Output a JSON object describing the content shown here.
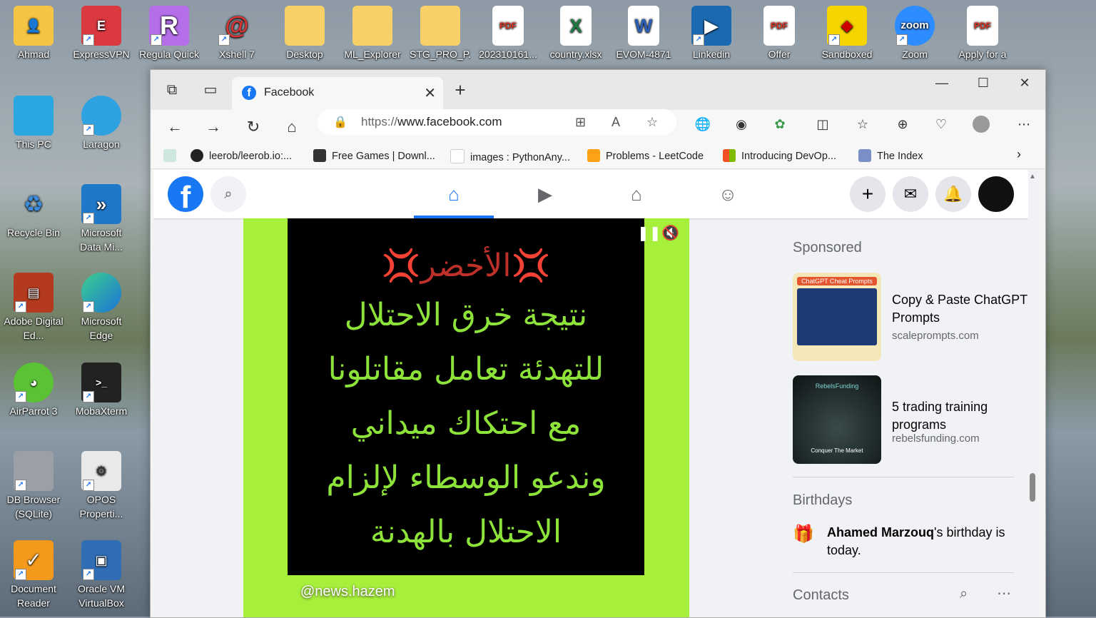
{
  "desktop": {
    "row1": [
      "Ahmad",
      "ExpressVPN",
      "Regula Quick",
      "Xshell 7",
      "Desktop",
      "ML_Explorer",
      "STG_PRO_P...",
      "202310161...",
      "country.xlsx",
      "EVOM-4871",
      "Linkedin",
      "Offer",
      "Sandboxed",
      "Zoom",
      "Apply for a"
    ],
    "col1": [
      "This PC",
      "Recycle Bin",
      "Adobe Digital Ed...",
      "AirParrot 3",
      "DB Browser (SQLite)",
      "Document Reader"
    ],
    "col2": [
      "Laragon",
      "Microsoft Data Mi...",
      "Microsoft Edge",
      "MobaXterm",
      "OPOS Properti...",
      "Oracle VM VirtualBox"
    ]
  },
  "browser": {
    "tab_title": "Facebook",
    "url_prefix": "https://",
    "url_host": "www.facebook.com",
    "bookmarks": [
      "leerob/leerob.io:...",
      "Free Games | Downl...",
      "images : PythonAny...",
      "Problems - LeetCode",
      "Introducing DevOp...",
      "The Index"
    ]
  },
  "post": {
    "line1": "💢الأخضر💢",
    "line2": "نتيجة خرق الاحتلال",
    "line3": "للتهدئة تعامل مقاتلونا",
    "line4": "مع احتكاك ميداني",
    "line5": "وندعو الوسطاء لإلزام",
    "line6": "الاحتلال بالهدنة",
    "handle": "@news.hazem"
  },
  "sidebar": {
    "sponsored": "Sponsored",
    "ads": [
      {
        "title": "Copy & Paste ChatGPT Prompts",
        "domain": "scaleprompts.com",
        "thumb_header": "ChatGPT Cheat Prompts"
      },
      {
        "title": "5 trading training programs",
        "domain": "rebelsfunding.com",
        "thumb_header": "RebelsFunding",
        "thumb_footer": "Conquer The Market"
      }
    ],
    "birthdays": "Birthdays",
    "birthday_name": "Ahamed Marzouq",
    "birthday_text": "'s birthday is today.",
    "contacts": "Contacts"
  },
  "colors": {
    "fb_blue": "#1877f2",
    "post_bg": "#a6ef3a",
    "arabic_text": "#8ee33a"
  }
}
